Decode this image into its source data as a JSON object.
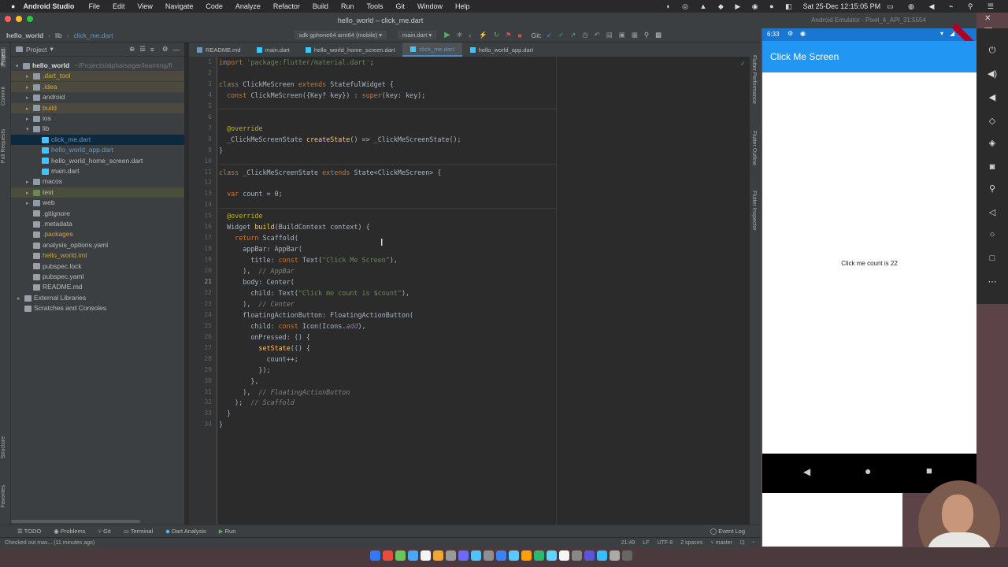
{
  "menubar": {
    "app": "Android Studio",
    "items": [
      "File",
      "Edit",
      "View",
      "Navigate",
      "Code",
      "Analyze",
      "Refactor",
      "Build",
      "Run",
      "Tools",
      "Git",
      "Window",
      "Help"
    ],
    "datetime": "Sat 25-Dec 12:15:05 PM"
  },
  "window": {
    "title": "hello_world – click_me.dart"
  },
  "nav": {
    "crumbs": [
      "hello_world",
      "lib",
      "click_me.dart"
    ],
    "device": "sdk gphone64 arm64 (mobile)",
    "run_config": "main.dart",
    "git_label": "Git:"
  },
  "tabs": [
    "README.md",
    "main.dart",
    "hello_world_home_screen.dart",
    "click_me.dart",
    "hello_world_app.dart"
  ],
  "project": {
    "header": "Project",
    "root": "hello_world",
    "root_path": "~/Projects/alpha/sagar/learning/fl",
    "items": [
      {
        "label": ".dart_tool",
        "indent": 1,
        "arrow": "▸",
        "color": "#c8a94a",
        "kind": "folder-excluded"
      },
      {
        "label": ".idea",
        "indent": 1,
        "arrow": "▸",
        "color": "#c8a94a",
        "kind": "folder-excluded"
      },
      {
        "label": "android",
        "indent": 1,
        "arrow": "▸",
        "color": "#bbbbbb",
        "kind": "folder"
      },
      {
        "label": "build",
        "indent": 1,
        "arrow": "▸",
        "color": "#c8a94a",
        "kind": "folder-excluded"
      },
      {
        "label": "ios",
        "indent": 1,
        "arrow": "▸",
        "color": "#bbbbbb",
        "kind": "folder"
      },
      {
        "label": "lib",
        "indent": 1,
        "arrow": "▾",
        "color": "#bbbbbb",
        "kind": "folder"
      },
      {
        "label": "click_me.dart",
        "indent": 2,
        "arrow": "",
        "color": "#6897bb",
        "kind": "dart",
        "selected": true
      },
      {
        "label": "hello_world_app.dart",
        "indent": 2,
        "arrow": "",
        "color": "#6897bb",
        "kind": "dart"
      },
      {
        "label": "hello_world_home_screen.dart",
        "indent": 2,
        "arrow": "",
        "color": "#bbbbbb",
        "kind": "dart"
      },
      {
        "label": "main.dart",
        "indent": 2,
        "arrow": "",
        "color": "#bbbbbb",
        "kind": "dart"
      },
      {
        "label": "macos",
        "indent": 1,
        "arrow": "▸",
        "color": "#bbbbbb",
        "kind": "folder"
      },
      {
        "label": "test",
        "indent": 1,
        "arrow": "▸",
        "color": "#bbbbbb",
        "kind": "folder-test"
      },
      {
        "label": "web",
        "indent": 1,
        "arrow": "▸",
        "color": "#bbbbbb",
        "kind": "folder"
      },
      {
        "label": ".gitignore",
        "indent": 1,
        "arrow": "",
        "color": "#bbbbbb",
        "kind": "file"
      },
      {
        "label": ".metadata",
        "indent": 1,
        "arrow": "",
        "color": "#bbbbbb",
        "kind": "file"
      },
      {
        "label": ".packages",
        "indent": 1,
        "arrow": "",
        "color": "#c8a94a",
        "kind": "file"
      },
      {
        "label": "analysis_options.yaml",
        "indent": 1,
        "arrow": "",
        "color": "#bbbbbb",
        "kind": "file"
      },
      {
        "label": "hello_world.iml",
        "indent": 1,
        "arrow": "",
        "color": "#c8a94a",
        "kind": "file"
      },
      {
        "label": "pubspec.lock",
        "indent": 1,
        "arrow": "",
        "color": "#bbbbbb",
        "kind": "file"
      },
      {
        "label": "pubspec.yaml",
        "indent": 1,
        "arrow": "",
        "color": "#bbbbbb",
        "kind": "file"
      },
      {
        "label": "README.md",
        "indent": 1,
        "arrow": "",
        "color": "#bbbbbb",
        "kind": "file"
      },
      {
        "label": "External Libraries",
        "indent": 0,
        "arrow": "▸",
        "color": "#bbbbbb",
        "kind": "lib"
      },
      {
        "label": "Scratches and Consoles",
        "indent": 0,
        "arrow": "",
        "color": "#bbbbbb",
        "kind": "scratch"
      }
    ]
  },
  "code_lines": [
    "import 'package:flutter/material.dart';",
    "",
    "class ClickMeScreen extends StatefulWidget {",
    "  const ClickMeScreen({Key? key}) : super(key: key);",
    "",
    "",
    "  @override",
    "  _ClickMeScreenState createState() => _ClickMeScreenState();",
    "}",
    "",
    "class _ClickMeScreenState extends State<ClickMeScreen> {",
    "",
    "  var count = 0;",
    "",
    "  @override",
    "  Widget build(BuildContext context) {",
    "    return Scaffold(",
    "      appBar: AppBar(",
    "        title: const Text(\"Click Me Screen\"),",
    "      ),  // AppBar",
    "      body: Center(",
    "        child: Text(\"Click me count is $count\"),",
    "      ),  // Center",
    "      floatingActionButton: FloatingActionButton(",
    "        child: const Icon(Icons.add),",
    "        onPressed: () {",
    "          setState(() {",
    "            count++;",
    "          });",
    "        },",
    "      ),  // FloatingActionButton",
    "    );  // Scaffold",
    "  }",
    "}"
  ],
  "right_tools": [
    "Flutter Performance",
    "Flutter Outline",
    "Flutter Inspector"
  ],
  "left_tools": [
    "Project",
    "Commit",
    "Pull Requests",
    "Structure",
    "Favorites"
  ],
  "bottom_tools": [
    "TODO",
    "Problems",
    "Git",
    "Terminal",
    "Dart Analysis",
    "Run"
  ],
  "event_log": "Event Log",
  "status": {
    "message": "Checked out mas... (11 minutes ago)",
    "position": "21:49",
    "line_sep": "LF",
    "encoding": "UTF-8",
    "indent": "2 spaces",
    "branch": "master"
  },
  "emulator": {
    "title": "Android Emulator - Pixel_4_API_31:5554",
    "time": "6:33",
    "app_title": "Click Me Screen",
    "count_text": "Click me count is 22",
    "fab_icon": "+",
    "count_value": 22
  },
  "colors": {
    "accent": "#2196f3",
    "statusbar": "#1976d2",
    "keyword": "#cc7832",
    "string": "#6a8759",
    "annotation": "#bbb529",
    "selection": "#0d293e"
  }
}
